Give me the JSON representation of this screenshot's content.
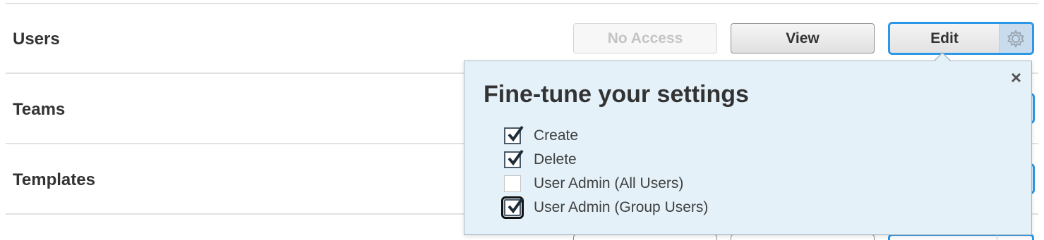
{
  "rows": [
    {
      "label": "Users"
    },
    {
      "label": "Teams"
    },
    {
      "label": "Templates"
    }
  ],
  "buttons": {
    "no_access": "No Access",
    "view": "View",
    "edit": "Edit"
  },
  "popover": {
    "title": "Fine-tune your settings",
    "close_icon": "×",
    "options": [
      {
        "label": "Create",
        "checked": true
      },
      {
        "label": "Delete",
        "checked": true
      },
      {
        "label": "User Admin (All Users)",
        "checked": false
      },
      {
        "label": "User Admin (Group Users)",
        "checked": true
      }
    ]
  },
  "icons": {
    "gear": "gear-icon",
    "close": "close-icon",
    "checkmark": "checkmark-icon"
  },
  "colors": {
    "accent": "#2b97e6",
    "popover_bg": "#e4f1f9",
    "gear_bg": "#c9dcee"
  }
}
